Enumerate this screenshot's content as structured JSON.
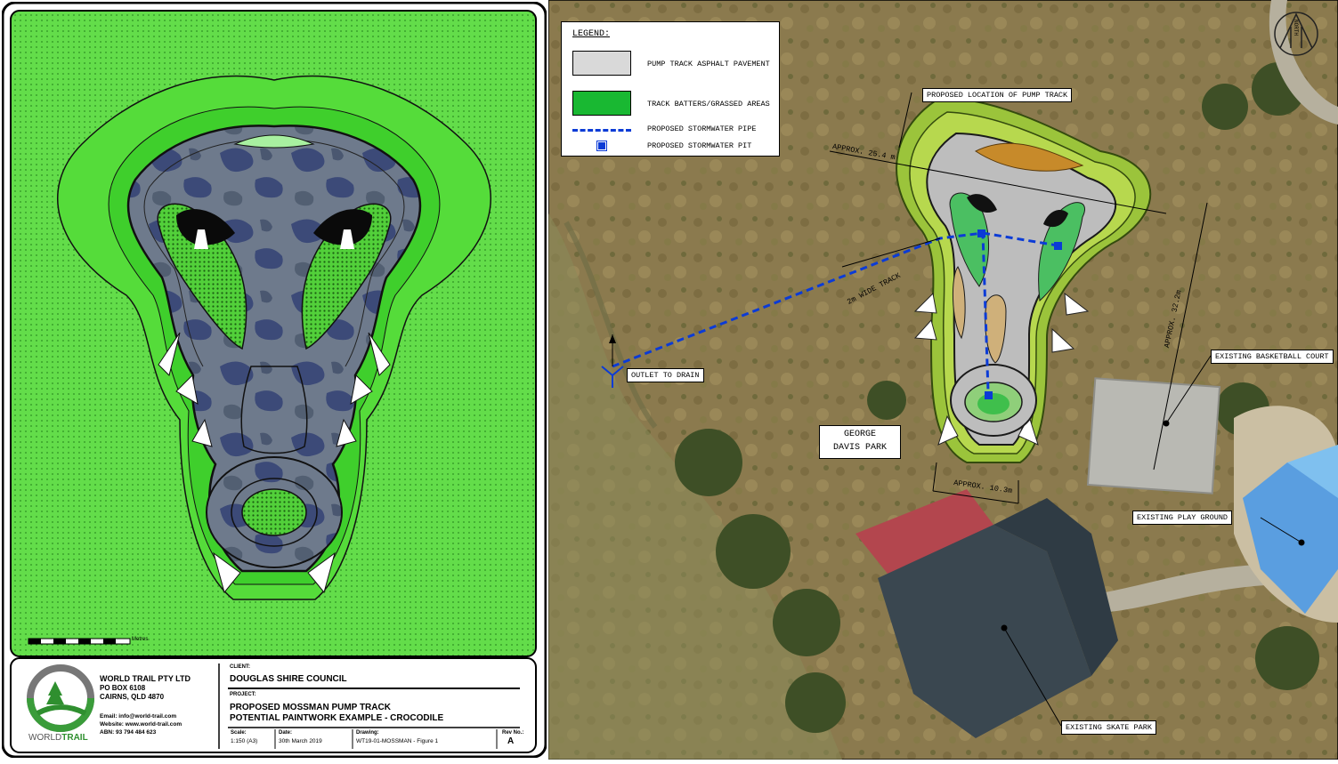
{
  "title_block": {
    "company": "WORLD TRAIL PTY LTD",
    "po_box": "PO BOX 6108",
    "city": "CAIRNS, QLD 4870",
    "email": "Email: info@world-trail.com",
    "website": "Website: www.world-trail.com",
    "abn": "ABN: 93 794 484 623",
    "logo_text_world": "WORLD",
    "logo_text_trail": "TRAIL",
    "client_label": "CLIENT:",
    "client": "DOUGLAS SHIRE COUNCIL",
    "project_label": "PROJECT:",
    "project_line1": "PROPOSED MOSSMAN PUMP TRACK",
    "project_line2": "POTENTIAL PAINTWORK EXAMPLE - CROCODILE",
    "scale_label": "Scale:",
    "scale": "1:150 (A3)",
    "date_label": "Date:",
    "date": "30th March 2019",
    "drawing_label": "Drawing:",
    "drawing": "WT19-01-MOSSMAN - Figure 1",
    "rev_label": "Rev No.:",
    "rev": "A"
  },
  "scale_bar_unit": "Metres",
  "legend": {
    "title": "LEGEND:",
    "items": [
      {
        "label": "PUMP TRACK ASPHALT PAVEMENT",
        "swatch": "asphalt",
        "color": "#d9d9d9"
      },
      {
        "label": "TRACK BATTERS/GRASSED AREAS",
        "swatch": "grass",
        "color": "#19b832"
      },
      {
        "label": "PROPOSED STORMWATER PIPE",
        "swatch": "pipe",
        "color": "#0b3bd6"
      },
      {
        "label": "PROPOSED STORMWATER PIT",
        "swatch": "pit",
        "color": "#0b3bd6"
      }
    ]
  },
  "north_label": "NORTH",
  "annotations": {
    "proposed_location": "PROPOSED LOCATION OF PUMP TRACK",
    "approx_width": "APPROX. 25.4 m",
    "approx_length": "APPROX. 32.2m",
    "approx_bottom": "APPROX. 10.3m",
    "track_width": "2m WIDE TRACK",
    "outlet": "OUTLET TO DRAIN",
    "park_line1": "GEORGE",
    "park_line2": "DAVIS PARK",
    "basketball": "EXISTING BASKETBALL COURT",
    "playground": "EXISTING PLAY GROUND",
    "skate_park": "EXISTING SKATE PARK"
  }
}
